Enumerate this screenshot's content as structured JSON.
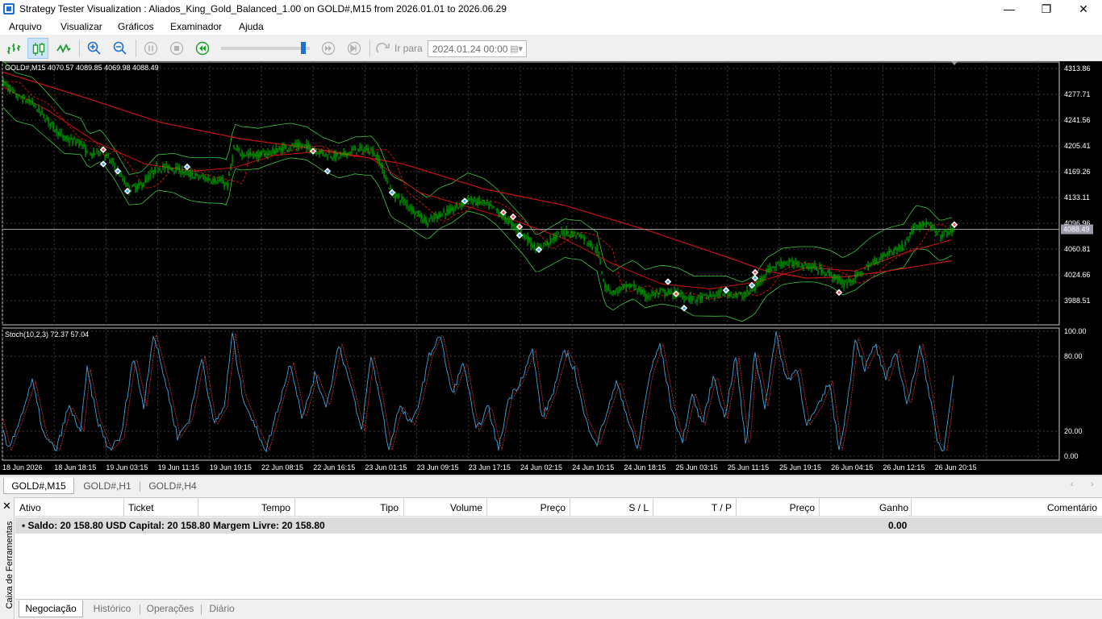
{
  "window": {
    "title": "Strategy Tester Visualization : Aliados_King_Gold_Balanced_1.00 on GOLD#,M15 from 2026.01.01 to 2026.06.29",
    "minimize": "—",
    "maximize": "❐",
    "close": "✕"
  },
  "menu": [
    "Arquivo",
    "Visualizar",
    "Gráficos",
    "Examinador",
    "Ajuda"
  ],
  "toolbar": {
    "goto_label": "Ir para",
    "goto_date": "2024.01.24 00:00",
    "speed_level": 0.95,
    "icons": [
      "bar-chart-icon",
      "candles-icon",
      "line-chart-icon",
      "zoom-in-icon",
      "zoom-out-icon",
      "pause-icon",
      "stop-icon",
      "play-icon",
      "step-forward-icon",
      "skip-end-icon",
      "goto-icon"
    ]
  },
  "colors": {
    "bull": "#00c000",
    "bear": "#00c000",
    "ma_fast": "#d01010",
    "ma_slow": "#c81414",
    "bands": "#3cc83c",
    "stoch_main": "#40a0d8",
    "stoch_signal": "#d03030",
    "grid": "#3c3c3c",
    "bid_line": "#9a9aa8"
  },
  "chart_data": {
    "type": "candlestick",
    "symbol_info": "GOLD#,M15  4070.57 4089.85 4069.98 4088.49",
    "price_ticks": [
      "4313.86",
      "4277.71",
      "4241.56",
      "4205.41",
      "4169.26",
      "4133.11",
      "4096.96",
      "4060.81",
      "4024.66",
      "3988.51"
    ],
    "price_values": [
      4313.86,
      4277.71,
      4241.56,
      4205.41,
      4169.26,
      4133.11,
      4096.96,
      4060.81,
      4024.66,
      3988.51
    ],
    "ylim": [
      3965,
      4322
    ],
    "current_price": "4088.49",
    "current_value": 4088.49,
    "price_anchors": [
      [
        0,
        4300
      ],
      [
        20,
        4275
      ],
      [
        40,
        4265
      ],
      [
        60,
        4240
      ],
      [
        80,
        4215
      ],
      [
        100,
        4210
      ],
      [
        110,
        4190
      ],
      [
        125,
        4200
      ],
      [
        140,
        4180
      ],
      [
        160,
        4145
      ],
      [
        175,
        4150
      ],
      [
        195,
        4175
      ],
      [
        215,
        4175
      ],
      [
        235,
        4165
      ],
      [
        255,
        4160
      ],
      [
        275,
        4155
      ],
      [
        282,
        4150
      ],
      [
        290,
        4200
      ],
      [
        300,
        4195
      ],
      [
        320,
        4192
      ],
      [
        340,
        4198
      ],
      [
        360,
        4205
      ],
      [
        380,
        4205
      ],
      [
        400,
        4195
      ],
      [
        420,
        4190
      ],
      [
        440,
        4200
      ],
      [
        460,
        4200
      ],
      [
        470,
        4185
      ],
      [
        485,
        4140
      ],
      [
        500,
        4128
      ],
      [
        510,
        4118
      ],
      [
        530,
        4098
      ],
      [
        545,
        4110
      ],
      [
        560,
        4115
      ],
      [
        580,
        4130
      ],
      [
        600,
        4125
      ],
      [
        615,
        4115
      ],
      [
        630,
        4100
      ],
      [
        650,
        4080
      ],
      [
        665,
        4060
      ],
      [
        685,
        4075
      ],
      [
        700,
        4085
      ],
      [
        720,
        4080
      ],
      [
        740,
        4060
      ],
      [
        750,
        4010
      ],
      [
        760,
        4000
      ],
      [
        770,
        4005
      ],
      [
        785,
        4010
      ],
      [
        800,
        3995
      ],
      [
        820,
        4000
      ],
      [
        840,
        3998
      ],
      [
        860,
        3990
      ],
      [
        880,
        3995
      ],
      [
        900,
        4000
      ],
      [
        920,
        3995
      ],
      [
        935,
        4005
      ],
      [
        950,
        4030
      ],
      [
        970,
        4042
      ],
      [
        990,
        4040
      ],
      [
        1010,
        4035
      ],
      [
        1030,
        4025
      ],
      [
        1045,
        4012
      ],
      [
        1060,
        4020
      ],
      [
        1080,
        4040
      ],
      [
        1100,
        4055
      ],
      [
        1120,
        4065
      ],
      [
        1135,
        4095
      ],
      [
        1150,
        4095
      ],
      [
        1165,
        4080
      ],
      [
        1183,
        4088
      ]
    ],
    "ma_slow_anchors": [
      [
        0,
        4310
      ],
      [
        100,
        4275
      ],
      [
        200,
        4238
      ],
      [
        300,
        4215
      ],
      [
        400,
        4200
      ],
      [
        500,
        4180
      ],
      [
        600,
        4145
      ],
      [
        700,
        4122
      ],
      [
        800,
        4088
      ],
      [
        900,
        4050
      ],
      [
        950,
        4030
      ],
      [
        1000,
        4020
      ],
      [
        1050,
        4022
      ],
      [
        1100,
        4030
      ],
      [
        1183,
        4045
      ]
    ],
    "ma_fast_anchors": [
      [
        0,
        4290
      ],
      [
        60,
        4255
      ],
      [
        120,
        4210
      ],
      [
        180,
        4180
      ],
      [
        240,
        4170
      ],
      [
        290,
        4175
      ],
      [
        340,
        4192
      ],
      [
        400,
        4198
      ],
      [
        460,
        4188
      ],
      [
        520,
        4140
      ],
      [
        580,
        4120
      ],
      [
        640,
        4100
      ],
      [
        700,
        4075
      ],
      [
        760,
        4040
      ],
      [
        820,
        4012
      ],
      [
        880,
        4005
      ],
      [
        940,
        4015
      ],
      [
        1000,
        4035
      ],
      [
        1060,
        4030
      ],
      [
        1120,
        4055
      ],
      [
        1183,
        4075
      ]
    ],
    "markers": [
      {
        "x": 128,
        "v": 4200,
        "kind": "sell"
      },
      {
        "x": 128,
        "v": 4180,
        "kind": "buy"
      },
      {
        "x": 146,
        "v": 4170,
        "kind": "buy"
      },
      {
        "x": 158,
        "v": 4142,
        "kind": "buy"
      },
      {
        "x": 232,
        "v": 4176,
        "kind": "buy"
      },
      {
        "x": 388,
        "v": 4198,
        "kind": "sell"
      },
      {
        "x": 406,
        "v": 4170,
        "kind": "buy"
      },
      {
        "x": 486,
        "v": 4140,
        "kind": "buy"
      },
      {
        "x": 576,
        "v": 4128,
        "kind": "buy"
      },
      {
        "x": 624,
        "v": 4112,
        "kind": "sell"
      },
      {
        "x": 636,
        "v": 4106,
        "kind": "sell"
      },
      {
        "x": 644,
        "v": 4092,
        "kind": "sell"
      },
      {
        "x": 644,
        "v": 4080,
        "kind": "buy"
      },
      {
        "x": 668,
        "v": 4060,
        "kind": "buy"
      },
      {
        "x": 828,
        "v": 4015,
        "kind": "buy"
      },
      {
        "x": 838,
        "v": 3998,
        "kind": "sell"
      },
      {
        "x": 848,
        "v": 3978,
        "kind": "buy"
      },
      {
        "x": 900,
        "v": 4003,
        "kind": "buy"
      },
      {
        "x": 932,
        "v": 4010,
        "kind": "buy"
      },
      {
        "x": 936,
        "v": 4028,
        "kind": "sell"
      },
      {
        "x": 936,
        "v": 4020,
        "kind": "buy"
      },
      {
        "x": 1040,
        "v": 4000,
        "kind": "sell"
      },
      {
        "x": 1183,
        "v": 4095,
        "kind": "sell"
      }
    ],
    "stoch": {
      "label": "Stoch(10,2,3) 72.37 57.04",
      "ticks": [
        "100.00",
        "80.00",
        "20.00",
        "0.00"
      ],
      "tick_values": [
        100,
        80,
        20,
        0
      ],
      "ylim": [
        0,
        100
      ],
      "anchors": [
        [
          0,
          30
        ],
        [
          10,
          5
        ],
        [
          25,
          30
        ],
        [
          40,
          60
        ],
        [
          55,
          15
        ],
        [
          70,
          5
        ],
        [
          85,
          40
        ],
        [
          100,
          20
        ],
        [
          108,
          70
        ],
        [
          120,
          30
        ],
        [
          135,
          5
        ],
        [
          150,
          15
        ],
        [
          165,
          80
        ],
        [
          178,
          40
        ],
        [
          190,
          98
        ],
        [
          205,
          60
        ],
        [
          220,
          15
        ],
        [
          235,
          30
        ],
        [
          250,
          80
        ],
        [
          265,
          25
        ],
        [
          278,
          40
        ],
        [
          288,
          98
        ],
        [
          300,
          50
        ],
        [
          315,
          25
        ],
        [
          330,
          5
        ],
        [
          345,
          40
        ],
        [
          360,
          75
        ],
        [
          375,
          30
        ],
        [
          390,
          65
        ],
        [
          405,
          40
        ],
        [
          420,
          90
        ],
        [
          435,
          55
        ],
        [
          448,
          20
        ],
        [
          460,
          80
        ],
        [
          470,
          50
        ],
        [
          482,
          5
        ],
        [
          495,
          40
        ],
        [
          510,
          25
        ],
        [
          520,
          45
        ],
        [
          532,
          80
        ],
        [
          545,
          98
        ],
        [
          560,
          50
        ],
        [
          575,
          75
        ],
        [
          590,
          20
        ],
        [
          605,
          40
        ],
        [
          618,
          5
        ],
        [
          630,
          45
        ],
        [
          645,
          60
        ],
        [
          660,
          85
        ],
        [
          672,
          30
        ],
        [
          685,
          50
        ],
        [
          700,
          85
        ],
        [
          712,
          70
        ],
        [
          725,
          30
        ],
        [
          740,
          10
        ],
        [
          752,
          35
        ],
        [
          765,
          60
        ],
        [
          778,
          30
        ],
        [
          790,
          5
        ],
        [
          805,
          65
        ],
        [
          818,
          90
        ],
        [
          832,
          40
        ],
        [
          845,
          10
        ],
        [
          858,
          50
        ],
        [
          870,
          25
        ],
        [
          885,
          65
        ],
        [
          898,
          30
        ],
        [
          912,
          80
        ],
        [
          925,
          5
        ],
        [
          935,
          85
        ],
        [
          948,
          40
        ],
        [
          962,
          98
        ],
        [
          975,
          60
        ],
        [
          988,
          70
        ],
        [
          1000,
          25
        ],
        [
          1015,
          40
        ],
        [
          1028,
          60
        ],
        [
          1040,
          5
        ],
        [
          1050,
          40
        ],
        [
          1060,
          95
        ],
        [
          1072,
          70
        ],
        [
          1085,
          90
        ],
        [
          1098,
          60
        ],
        [
          1110,
          85
        ],
        [
          1125,
          40
        ],
        [
          1140,
          90
        ],
        [
          1152,
          50
        ],
        [
          1162,
          10
        ],
        [
          1170,
          5
        ],
        [
          1183,
          72
        ]
      ]
    },
    "time_labels": [
      "18 Jun 2026",
      "18 Jun 18:15",
      "19 Jun 03:15",
      "19 Jun 11:15",
      "19 Jun 19:15",
      "22 Jun 08:15",
      "22 Jun 16:15",
      "23 Jun 01:15",
      "23 Jun 09:15",
      "23 Jun 17:15",
      "24 Jun 02:15",
      "24 Jun 10:15",
      "24 Jun 18:15",
      "25 Jun 03:15",
      "25 Jun 11:15",
      "25 Jun 19:15",
      "26 Jun 04:15",
      "26 Jun 12:15",
      "26 Jun 20:15"
    ]
  },
  "symbol_tabs": [
    "GOLD#,M15",
    "GOLD#,H1",
    "GOLD#,H4"
  ],
  "symbol_tabs_scroll": [
    "‹",
    "›"
  ],
  "toolbox": {
    "close": "✕",
    "side_label": "Caixa de Ferramentas",
    "columns": [
      "Ativo",
      "Ticket",
      "Tempo",
      "Tipo",
      "Volume",
      "Preço",
      "S / L",
      "T / P",
      "Preço",
      "Ganho",
      "Comentário"
    ],
    "balance": "•  Saldo: 20 158.80 USD  Capital: 20 158.80  Margem Livre: 20 158.80",
    "profit": "0.00",
    "tabs": [
      "Negociação",
      "Histórico",
      "Operações",
      "Diário"
    ]
  }
}
